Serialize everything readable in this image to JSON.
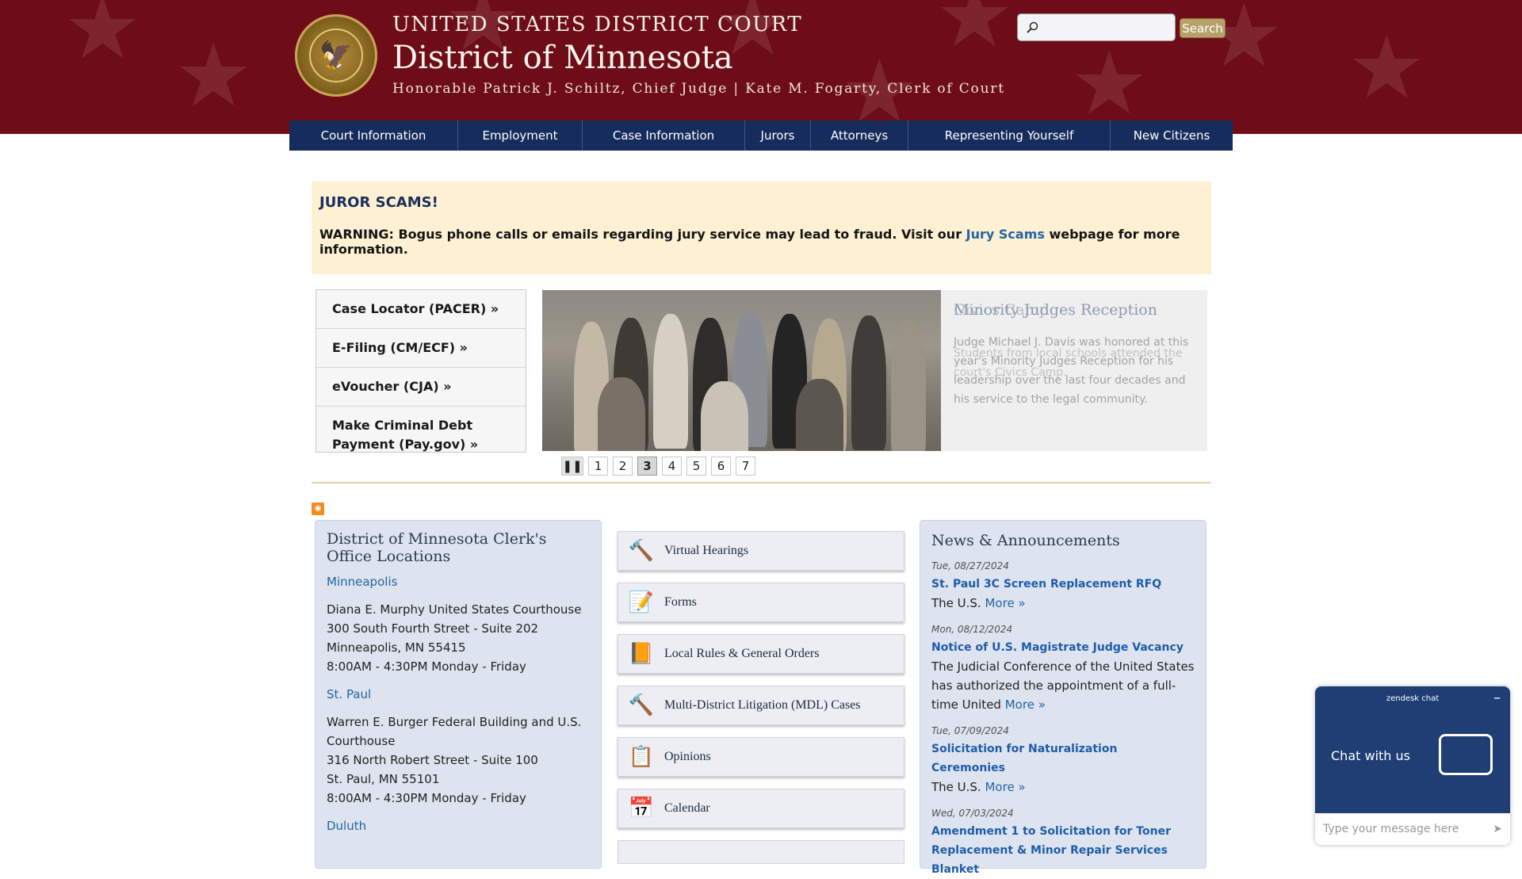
{
  "header": {
    "court_label": "UNITED STATES DISTRICT COURT",
    "district": "District of Minnesota",
    "judges_line": "Honorable Patrick J. Schiltz, Chief Judge | Kate M. Fogarty, Clerk of Court",
    "search_button": "Search",
    "search_placeholder": ""
  },
  "nav": {
    "items": [
      "Court Information",
      "Employment",
      "Case Information",
      "Jurors",
      "Attorneys",
      "Representing Yourself",
      "New Citizens"
    ]
  },
  "alert": {
    "title": "JUROR SCAMS!",
    "message_prefix": "WARNING: Bogus phone calls or emails regarding jury service may lead to fraud. Visit our ",
    "link_text": "Jury Scams",
    "message_suffix": " webpage for more information."
  },
  "quick_links": [
    "Case Locator (PACER) »",
    "E-Filing (CM/ECF) »",
    "eVoucher (CJA) »",
    "Make Criminal Debt Payment (Pay.gov) »"
  ],
  "slideshow": {
    "title_a": "Minority Judges Reception",
    "title_b": "Civics Camp",
    "desc_a": "Judge Michael J. Davis was honored at this year's Minority Judges Reception for his leadership over the last four decades and his service to the legal community.",
    "desc_b": "Students from local schools attended the court's Civics Camp.",
    "pause_label": "❚❚",
    "pages": [
      "1",
      "2",
      "3",
      "4",
      "5",
      "6",
      "7"
    ],
    "active_page": "3"
  },
  "locations": {
    "title": "District of Minnesota Clerk's Office Locations",
    "offices": [
      {
        "city": "Minneapolis",
        "lines": [
          "Diana E. Murphy United States Courthouse",
          "300 South Fourth Street - Suite 202",
          "Minneapolis, MN 55415",
          "8:00AM - 4:30PM Monday - Friday"
        ]
      },
      {
        "city": "St. Paul",
        "lines": [
          "Warren E. Burger Federal Building and U.S. Courthouse",
          "316 North Robert Street - Suite 100",
          "St. Paul, MN 55101",
          "8:00AM - 4:30PM Monday - Friday"
        ]
      },
      {
        "city": "Duluth",
        "lines": []
      }
    ]
  },
  "services": [
    {
      "label": "Virtual Hearings",
      "icon": "gavel-icon"
    },
    {
      "label": "Forms",
      "icon": "form-icon"
    },
    {
      "label": "Local Rules & General Orders",
      "icon": "book-icon"
    },
    {
      "label": "Multi-District Litigation (MDL) Cases",
      "icon": "gavel-icon"
    },
    {
      "label": "Opinions",
      "icon": "document-icon"
    },
    {
      "label": "Calendar",
      "icon": "calendar-icon"
    }
  ],
  "news": {
    "title": "News & Announcements",
    "items": [
      {
        "date": "Tue, 08/27/2024",
        "title": "St. Paul 3C Screen Replacement RFQ",
        "body": "The U.S.",
        "more": "More »"
      },
      {
        "date": "Mon, 08/12/2024",
        "title": "Notice of U.S. Magistrate Judge Vacancy",
        "body": "The Judicial Conference of the United States has authorized the appointment of a full-time United",
        "more": "More »"
      },
      {
        "date": "Tue, 07/09/2024",
        "title": "Solicitation for Naturalization Ceremonies",
        "body": "The U.S.",
        "more": "More »"
      },
      {
        "date": "Wed, 07/03/2024",
        "title": "Amendment 1 to Solicitation for Toner Replacement & Minor Repair Services Blanket",
        "body": "",
        "more": ""
      }
    ]
  },
  "chat": {
    "brand": "zendesk chat",
    "minimize": "–",
    "heading": "Chat with us",
    "input_placeholder": "Type your message here"
  },
  "colors": {
    "header_bg": "#6e0d18",
    "nav_bg": "#162c5d",
    "alert_bg": "#fdf0d3",
    "link": "#2563a5",
    "chat_bg": "#1f3e74"
  }
}
